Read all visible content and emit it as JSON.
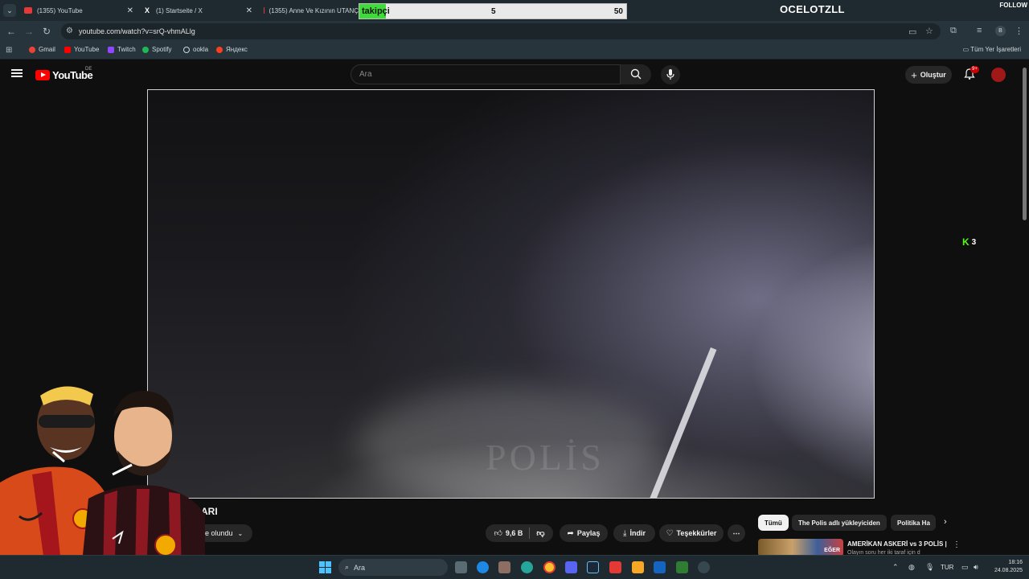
{
  "browser": {
    "tabs": [
      {
        "title": "(1355) YouTube",
        "favicon": "youtube-icon"
      },
      {
        "title": "(1) Startseite / X",
        "favicon": "x-icon"
      },
      {
        "title": "(1355) Anne Ve Kızının UTANÇ",
        "favicon": "youtube-icon"
      }
    ],
    "url": "youtube.com/watch?v=srQ-vhmALlg",
    "bookmarks": [
      "Gmail",
      "YouTube",
      "Twitch",
      "Spotify",
      "ookla",
      "Яндекс"
    ],
    "all_bookmarks": "Tüm Yer İşaretleri",
    "profile_initial": "B"
  },
  "stream_overlay": {
    "follow_label": "takipçi",
    "follow_current": "5",
    "follow_goal": "50",
    "follow_progress": 0.1,
    "streamer_name": "OCELOTZLL",
    "follow_tag": "FOLLOW",
    "k_count": "3",
    "k_letter": "K"
  },
  "youtube": {
    "country": "DE",
    "logo_text": "YouTube",
    "search_placeholder": "Ara",
    "create_label": "Oluştur",
    "notifications_badge": "9+",
    "video_watermark": "POLİS",
    "video_title_visible": "ARI",
    "subscribe_state": "ne olundu",
    "likes": "9,6 B",
    "share_label": "Paylaş",
    "download_label": "İndir",
    "thanks_label": "Teşekkürler",
    "chips": [
      "Tümü",
      "The Polis adlı yükleyiciden",
      "Politika Ha"
    ],
    "recommendation": {
      "title": "AMERİKAN ASKERİ vs 3 POLİS |",
      "subtitle": "Olayın soru her iki taraf için d",
      "thumb_label": "EĞER"
    }
  },
  "taskbar": {
    "search_placeholder": "Ara",
    "language": "TUR",
    "time": "18:16",
    "date": "24.08.2025"
  },
  "colors": {
    "youtube_red": "#ff0000",
    "follow_fill": "#3ddc39",
    "kick_green": "#53fc18"
  }
}
